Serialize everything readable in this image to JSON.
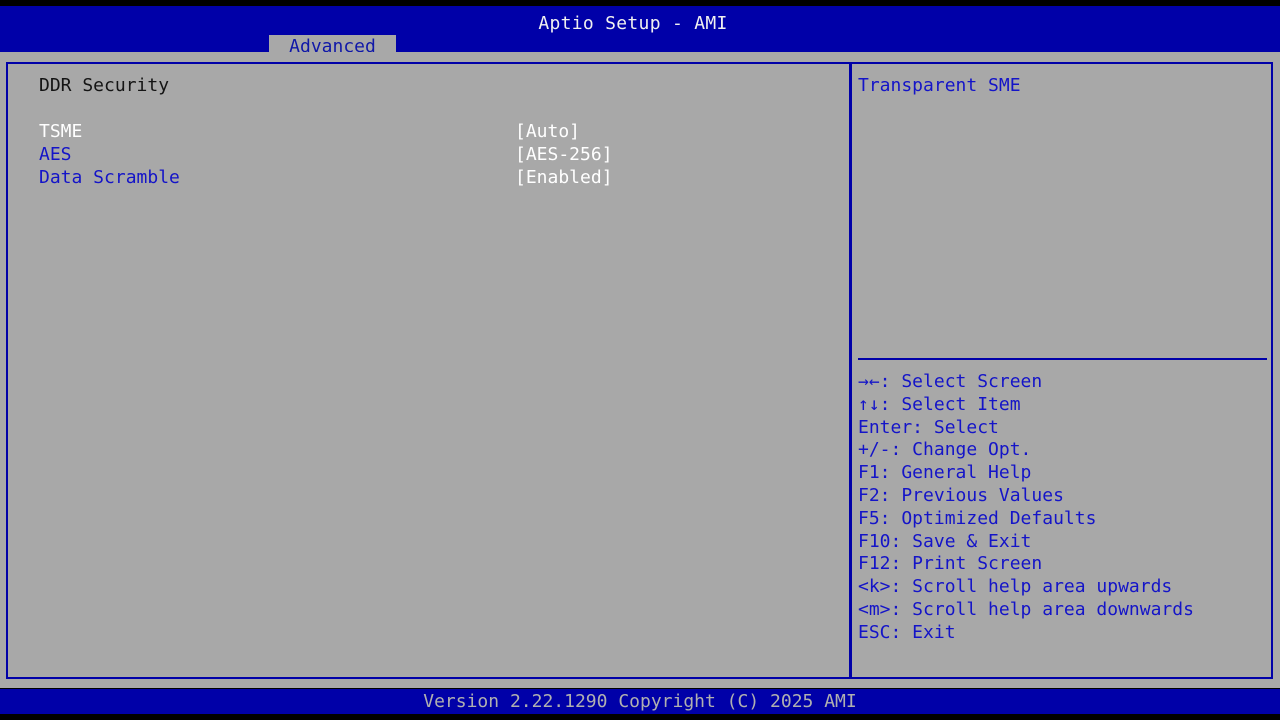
{
  "header": {
    "title": "Aptio Setup - AMI",
    "tabs": [
      {
        "label": "Advanced",
        "active": true
      }
    ]
  },
  "main": {
    "section_title": "DDR Security",
    "options": [
      {
        "label": "TSME",
        "value": "[Auto]",
        "selected": true
      },
      {
        "label": "AES",
        "value": "[AES-256]",
        "selected": false
      },
      {
        "label": "Data Scramble",
        "value": "[Enabled]",
        "selected": false
      }
    ]
  },
  "help": {
    "description": "Transparent SME",
    "keys": [
      "→←: Select Screen",
      "↑↓: Select Item",
      "Enter: Select",
      "+/-: Change Opt.",
      "F1: General Help",
      "F2: Previous Values",
      "F5: Optimized Defaults",
      "F10: Save & Exit",
      "F12: Print Screen",
      "<k>: Scroll help area upwards",
      "<m>: Scroll help area downwards",
      "ESC: Exit"
    ]
  },
  "footer": {
    "version": "Version 2.22.1290 Copyright (C) 2025 AMI"
  },
  "colors": {
    "accent_blue": "#0000a8",
    "panel_gray": "#a8a8a8",
    "option_label": "#1414c8",
    "highlight": "#ffffff"
  }
}
